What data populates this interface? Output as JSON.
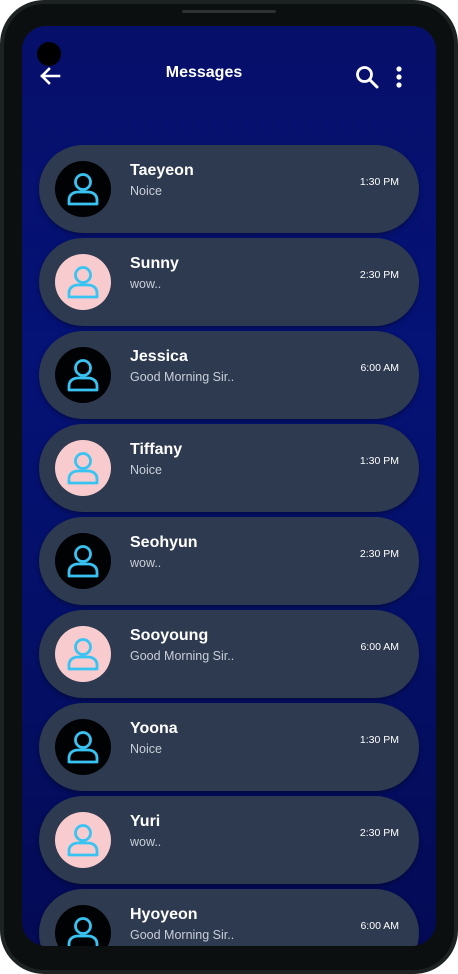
{
  "app_bar": {
    "title": "Messages",
    "back_icon": "arrow-left-icon",
    "search_icon": "search-icon",
    "more_icon": "more-vertical-icon"
  },
  "colors": {
    "background_top": "#06106a",
    "card": "#2d3a4f",
    "avatar_dark": "#010203",
    "avatar_pink": "#f8ccce",
    "person_icon": "#38c3f2"
  },
  "conversations": [
    {
      "name": "Taeyeon",
      "preview": "Noice",
      "time": "1:30 PM",
      "avatar": "dark",
      "icon": "person-icon"
    },
    {
      "name": "Sunny",
      "preview": "wow..",
      "time": "2:30 PM",
      "avatar": "pink",
      "icon": "person-icon"
    },
    {
      "name": "Jessica",
      "preview": "Good Morning Sir..",
      "time": "6:00 AM",
      "avatar": "dark",
      "icon": "person-icon"
    },
    {
      "name": "Tiffany",
      "preview": "Noice",
      "time": "1:30 PM",
      "avatar": "pink",
      "icon": "person-icon"
    },
    {
      "name": "Seohyun",
      "preview": "wow..",
      "time": "2:30 PM",
      "avatar": "dark",
      "icon": "person-icon"
    },
    {
      "name": "Sooyoung",
      "preview": "Good Morning Sir..",
      "time": "6:00 AM",
      "avatar": "pink",
      "icon": "person-icon"
    },
    {
      "name": "Yoona",
      "preview": "Noice",
      "time": "1:30 PM",
      "avatar": "dark",
      "icon": "person-icon"
    },
    {
      "name": "Yuri",
      "preview": "wow..",
      "time": "2:30 PM",
      "avatar": "pink",
      "icon": "person-icon"
    },
    {
      "name": "Hyoyeon",
      "preview": "Good Morning Sir..",
      "time": "6:00 AM",
      "avatar": "dark",
      "icon": "person-icon"
    }
  ]
}
